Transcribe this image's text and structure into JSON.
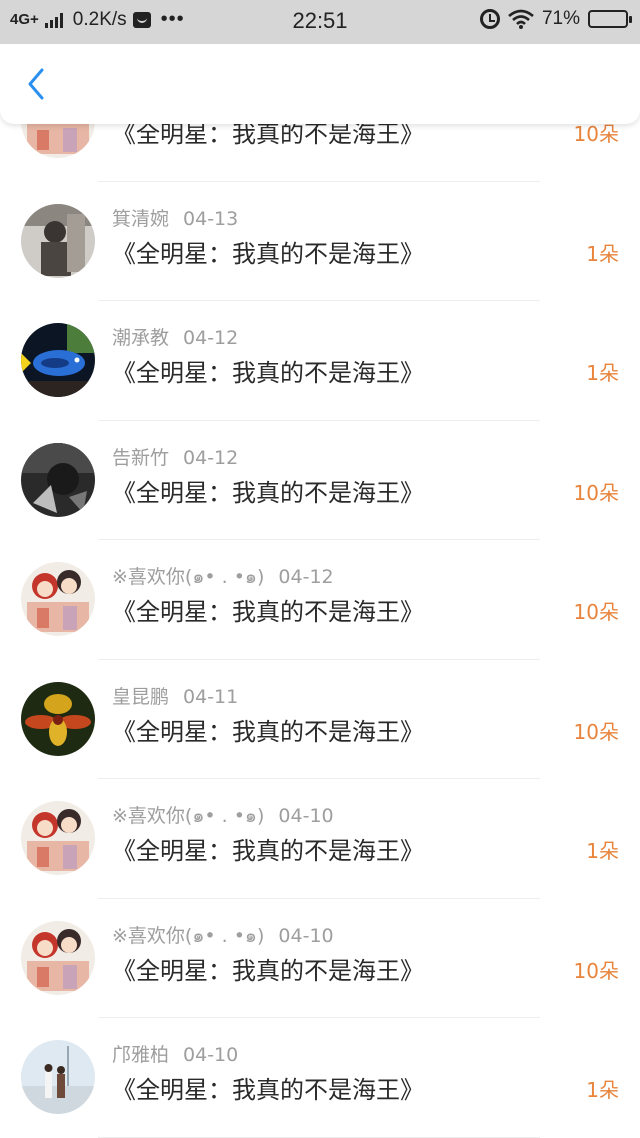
{
  "status_bar": {
    "network": "4G+",
    "speed": "0.2K/s",
    "dots": "•••",
    "time": "22:51",
    "battery": "71%",
    "battery_level": 0.71
  },
  "nav": {
    "back_icon": "chevron-left-icon",
    "accent_color": "#2b8ff0"
  },
  "count_color": "#e8843c",
  "gifts": [
    {
      "name": "",
      "date": "",
      "title": "《全明星：我真的不是海王》",
      "count": "10朵",
      "avatar": "anime"
    },
    {
      "name": "箕清婉",
      "date": "04-13",
      "title": "《全明星：我真的不是海王》",
      "count": "1朵",
      "avatar": "bw-photo"
    },
    {
      "name": "潮承教",
      "date": "04-12",
      "title": "《全明星：我真的不是海王》",
      "count": "1朵",
      "avatar": "fish"
    },
    {
      "name": "告新竹",
      "date": "04-12",
      "title": "《全明星：我真的不是海王》",
      "count": "10朵",
      "avatar": "dark"
    },
    {
      "name": "※喜欢你(๑• . •๑)",
      "date": "04-12",
      "title": "《全明星：我真的不是海王》",
      "count": "10朵",
      "avatar": "anime"
    },
    {
      "name": "皇昆鹏",
      "date": "04-11",
      "title": "《全明星：我真的不是海王》",
      "count": "10朵",
      "avatar": "flower"
    },
    {
      "name": "※喜欢你(๑• . •๑)",
      "date": "04-10",
      "title": "《全明星：我真的不是海王》",
      "count": "1朵",
      "avatar": "anime"
    },
    {
      "name": "※喜欢你(๑• . •๑)",
      "date": "04-10",
      "title": "《全明星：我真的不是海王》",
      "count": "10朵",
      "avatar": "anime"
    },
    {
      "name": "邝雅柏",
      "date": "04-10",
      "title": "《全明星：我真的不是海王》",
      "count": "1朵",
      "avatar": "couple"
    }
  ]
}
